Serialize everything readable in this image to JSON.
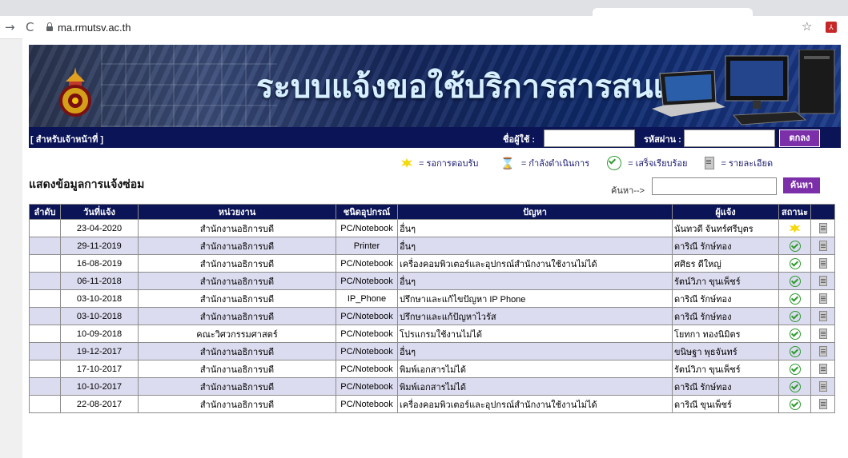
{
  "browser": {
    "url": "ma.rmutsv.ac.th"
  },
  "banner": {
    "title": "ระบบแจ้งขอใช้บริการสารสนเทศ"
  },
  "login": {
    "staff_link": "[ สำหรับเจ้าหน้าที่ ]",
    "username_label": "ชื่อผู้ใช้ :",
    "password_label": "รหัสผ่าน :",
    "button": "ตกลง"
  },
  "legend": {
    "new": "= รอการตอบรับ",
    "pending": "= กำลังดำเนินการ",
    "done": "= เสร็จเรียบร้อย",
    "detail": "= รายละเอียด"
  },
  "section_title": "แสดงข้อมูลการแจ้งซ่อม",
  "search": {
    "label": "ค้นหา-->",
    "button": "ค้นหา"
  },
  "table": {
    "headers": [
      "ลำดับ",
      "วันที่แจ้ง",
      "หน่วยงาน",
      "ชนิดอุปกรณ์",
      "ปัญหา",
      "ผู้แจ้ง",
      "สถานะ",
      ""
    ],
    "rows": [
      {
        "date": "23-04-2020",
        "unit": "สำนักงานอธิการบดี",
        "device": "PC/Notebook",
        "problem": "อื่นๆ",
        "reporter": "นันทวดี จันทร์ศรีบุตร",
        "status": "new"
      },
      {
        "date": "29-11-2019",
        "unit": "สำนักงานอธิการบดี",
        "device": "Printer",
        "problem": "อื่นๆ",
        "reporter": "ดาริณี รักษ์ทอง",
        "status": "done"
      },
      {
        "date": "16-08-2019",
        "unit": "สำนักงานอธิการบดี",
        "device": "PC/Notebook",
        "problem": "เครื่องคอมพิวเตอร์และอุปกรณ์สำนักงานใช้งานไม่ได้",
        "reporter": "ศศิธร ดีใหญ่",
        "status": "done"
      },
      {
        "date": "06-11-2018",
        "unit": "สำนักงานอธิการบดี",
        "device": "PC/Notebook",
        "problem": "อื่นๆ",
        "reporter": "รัตน์วิภา ขุนเพ็ชร์",
        "status": "done"
      },
      {
        "date": "03-10-2018",
        "unit": "สำนักงานอธิการบดี",
        "device": "IP_Phone",
        "problem": "ปรึกษาและแก้ไขปัญหา IP Phone",
        "reporter": "ดาริณี รักษ์ทอง",
        "status": "done"
      },
      {
        "date": "03-10-2018",
        "unit": "สำนักงานอธิการบดี",
        "device": "PC/Notebook",
        "problem": "ปรึกษาและแก้ปัญหาไวรัส",
        "reporter": "ดาริณี รักษ์ทอง",
        "status": "done"
      },
      {
        "date": "10-09-2018",
        "unit": "คณะวิศวกรรมศาสตร์",
        "device": "PC/Notebook",
        "problem": "โปรแกรมใช้งานไม่ได้",
        "reporter": "โยทกา ทองนิมิตร",
        "status": "done"
      },
      {
        "date": "19-12-2017",
        "unit": "สำนักงานอธิการบดี",
        "device": "PC/Notebook",
        "problem": "อื่นๆ",
        "reporter": "ขนิษฐา พุธจันทร์",
        "status": "done"
      },
      {
        "date": "17-10-2017",
        "unit": "สำนักงานอธิการบดี",
        "device": "PC/Notebook",
        "problem": "พิมพ์เอกสารไม่ได้",
        "reporter": "รัตน์วิภา ขุนเพ็ชร์",
        "status": "done"
      },
      {
        "date": "10-10-2017",
        "unit": "สำนักงานอธิการบดี",
        "device": "PC/Notebook",
        "problem": "พิมพ์เอกสารไม่ได้",
        "reporter": "ดาริณี รักษ์ทอง",
        "status": "done"
      },
      {
        "date": "22-08-2017",
        "unit": "สำนักงานอธิการบดี",
        "device": "PC/Notebook",
        "problem": "เครื่องคอมพิวเตอร์และอุปกรณ์สำนักงานใช้งานไม่ได้",
        "reporter": "ดาริณี ขุนเพ็ชร์",
        "status": "done"
      }
    ]
  }
}
